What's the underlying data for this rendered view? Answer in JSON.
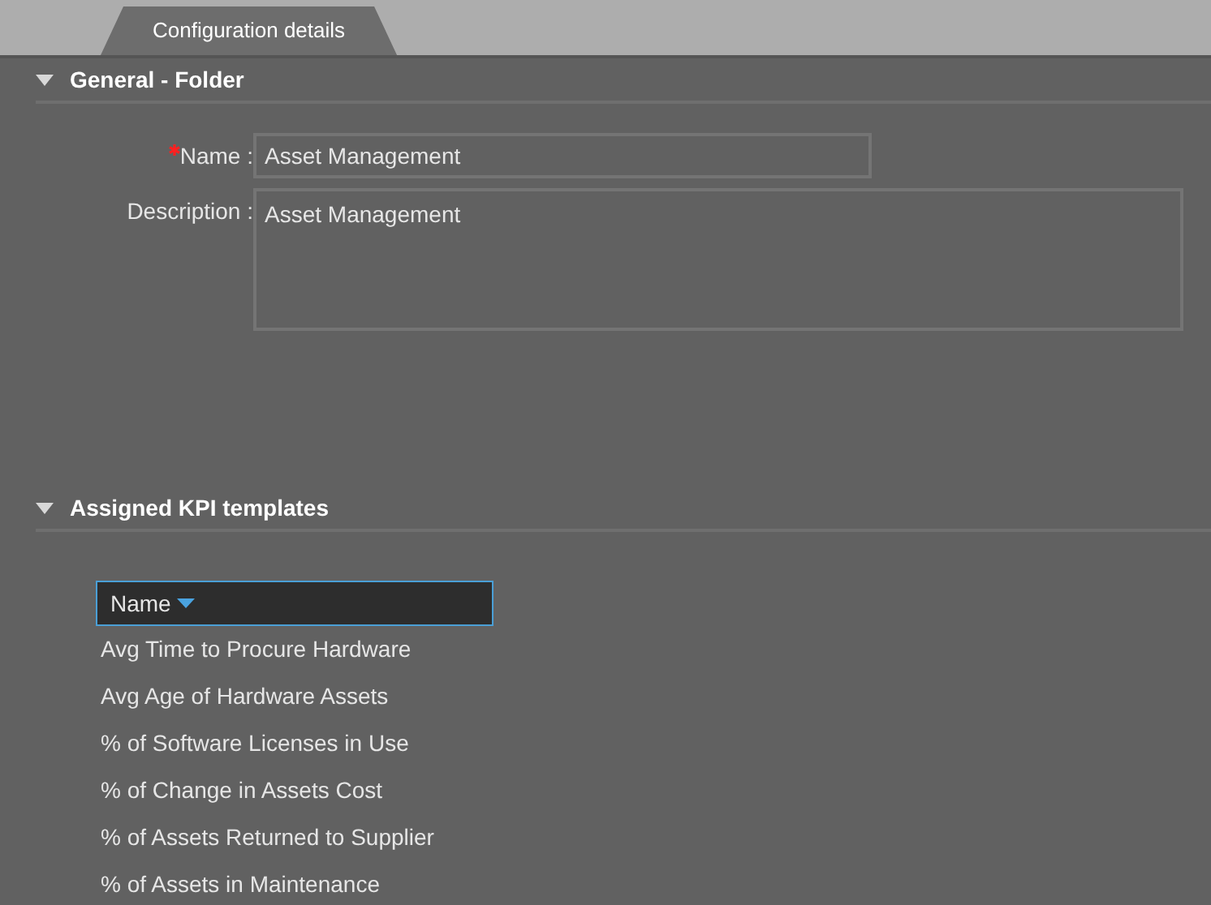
{
  "tabs": [
    {
      "label": "Configuration details",
      "selected": true
    }
  ],
  "sections": [
    {
      "title": "General - Folder",
      "expanded": true
    },
    {
      "title": "Assigned KPI templates",
      "expanded": true
    }
  ],
  "form": {
    "fields": [
      {
        "label": "Name :",
        "required": true,
        "value": "Asset Management",
        "kind": "input"
      },
      {
        "label": "Description :",
        "required": false,
        "value": "Asset Management",
        "kind": "textarea"
      }
    ]
  },
  "table": {
    "columns": [
      {
        "label": "Name",
        "sorted": true
      }
    ],
    "rows": [
      "Avg Time to Procure Hardware",
      "Avg Age of Hardware Assets",
      "% of Software Licenses in Use",
      "% of Change in Assets Cost",
      "% of Assets Returned to Supplier",
      "% of Assets in Maintenance"
    ]
  }
}
